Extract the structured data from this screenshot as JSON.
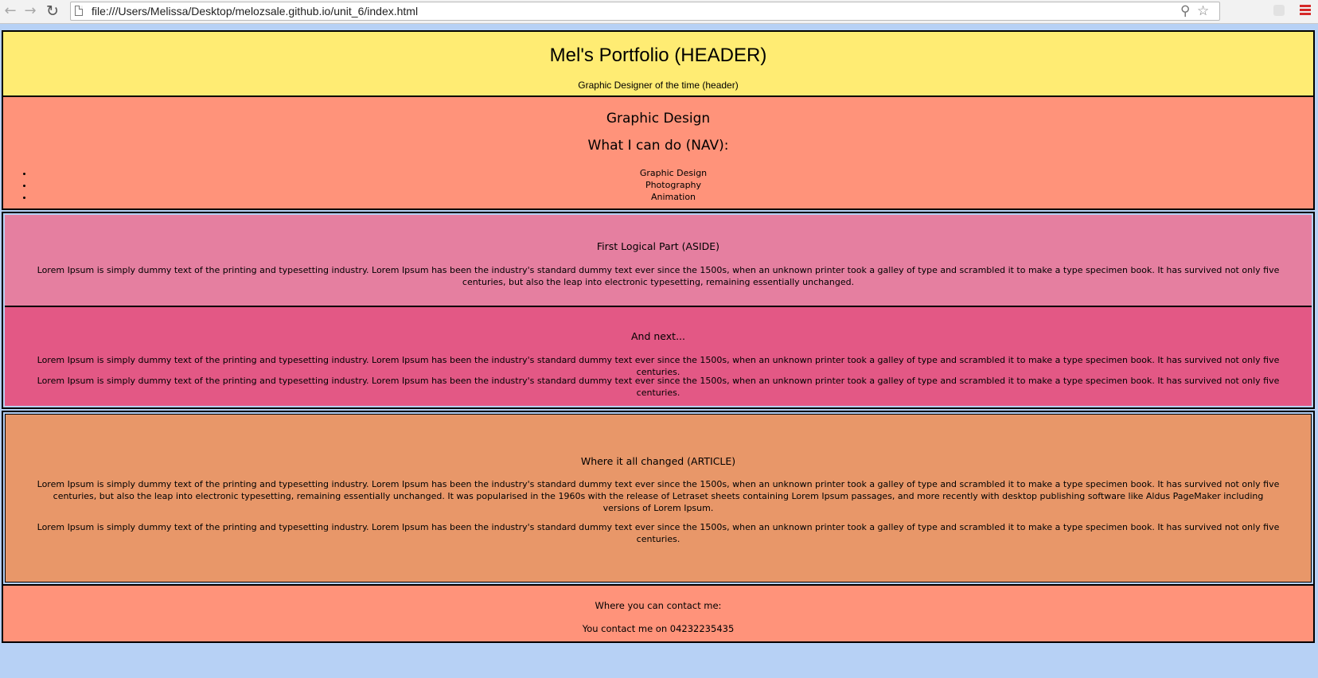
{
  "browser": {
    "url": "file:///Users/Melissa/Desktop/melozsale.github.io/unit_6/index.html",
    "back_icon": "←",
    "forward_icon": "→",
    "reload_icon": "↻",
    "zoom_icon": "⚲",
    "star_icon": "☆"
  },
  "header": {
    "title": "Mel's Portfolio (HEADER)",
    "subtitle": "Graphic Designer of the time (header)",
    "background": "#ffec73"
  },
  "nav": {
    "title": "Graphic Design",
    "subtitle": "What I can do (NAV):",
    "items": [
      "Graphic Design",
      "Photography",
      "Animation"
    ],
    "background": "#ff937a"
  },
  "aside_first": {
    "title": "First Logical Part (ASIDE)",
    "text": "Lorem Ipsum is simply dummy text of the printing and typesetting industry. Lorem Ipsum has been the industry's standard dummy text ever since the 1500s, when an unknown printer took a galley of type and scrambled it to make a type specimen book. It has survived not only five centuries, but also the leap into electronic typesetting, remaining essentially unchanged.",
    "background": "#e57fa0"
  },
  "aside_next": {
    "title": "And next...",
    "paragraphs": [
      "Lorem Ipsum is simply dummy text of the printing and typesetting industry. Lorem Ipsum has been the industry's standard dummy text ever since the 1500s, when an unknown printer took a galley of type and scrambled it to make a type specimen book. It has survived not only five centuries.",
      "Lorem Ipsum is simply dummy text of the printing and typesetting industry. Lorem Ipsum has been the industry's standard dummy text ever since the 1500s, when an unknown printer took a galley of type and scrambled it to make a type specimen book. It has survived not only five centuries."
    ],
    "background": "#e35885"
  },
  "article": {
    "title": "Where it all changed (ARTICLE)",
    "paragraphs": [
      "Lorem Ipsum is simply dummy text of the printing and typesetting industry. Lorem Ipsum has been the industry's standard dummy text ever since the 1500s, when an unknown printer took a galley of type and scrambled it to make a type specimen book. It has survived not only five centuries, but also the leap into electronic typesetting, remaining essentially unchanged. It was popularised in the 1960s with the release of Letraset sheets containing Lorem Ipsum passages, and more recently with desktop publishing software like Aldus PageMaker including versions of Lorem Ipsum.",
      "Lorem Ipsum is simply dummy text of the printing and typesetting industry. Lorem Ipsum has been the industry's standard dummy text ever since the 1500s, when an unknown printer took a galley of type and scrambled it to make a type specimen book. It has survived not only five centuries."
    ],
    "background": "#e89769"
  },
  "footer": {
    "title": "Where you can contact me:",
    "text": "You contact me on 04232235435",
    "background": "#ff937a"
  }
}
